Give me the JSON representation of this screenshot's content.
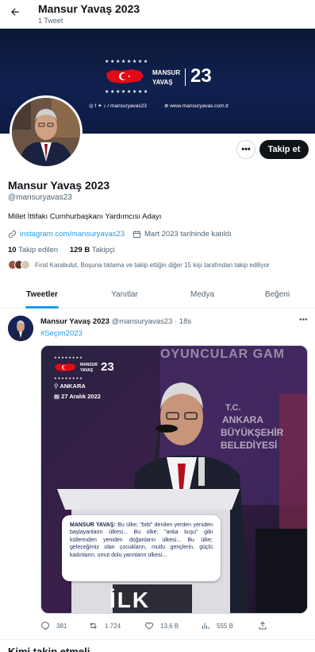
{
  "header": {
    "title": "Mansur Yavaş 2023",
    "subtitle": "1 Tweet"
  },
  "banner": {
    "stars": "★★★★★★★★",
    "name_line1": "MANSUR",
    "name_line2": "YAVAŞ",
    "number": "23",
    "social": "/ mansuryavas23",
    "website": "www.mansuryavas.com.tr"
  },
  "actions": {
    "more": "•••",
    "follow": "Takip et"
  },
  "profile": {
    "name": "Mansur Yavaş 2023",
    "handle": "@mansuryavas23",
    "bio": "Millet İttifakı Cumhurbaşkanı Yardımcısı Adayı",
    "link": "instagram.com/mansuryavas23",
    "joined": "Mart 2023 tarihinde katıldı",
    "following_count": "10",
    "following_label": "Takip edilen",
    "followers_count": "129 B",
    "followers_label": "Takipçi",
    "followed_by": "Fırat Karabulut, Boşuna tıklama ve takip ettiğin diğer 15 kişi tarafından takip ediliyor"
  },
  "tabs": [
    "Tweetler",
    "Yanıtlar",
    "Medya",
    "Beğeni"
  ],
  "tweet": {
    "name": "Mansur Yavaş 2023",
    "handle": "@mansuryavas23",
    "time": "· 18s",
    "hashtag": "#Seçim2023",
    "image": {
      "city": "ANKARA",
      "date": "27 Aralık 2022",
      "bg_text_1": "OYUNCULAR GAM",
      "bg_text_2": "T.C.",
      "bg_text_3": "ANKARA",
      "bg_text_4": "BÜYÜKŞEHİR",
      "bg_text_5": "BELEDİYESİ",
      "podium_text": "İLK",
      "quote_speaker": "MANSUR YAVAŞ:",
      "quote_text": "Bu ülke; \"bitti\" denilen yerden yeniden başlayanların ülkesi... Bu ülke; \"anka kuşu\" gibi küllerinden yeniden doğanların ülkesi... Bu ülke; geleceğimiz olan çocukların, mutlu gençlerin, güçlü kadınların, umut dolu yarınların ülkesi..."
    },
    "replies": "381",
    "retweets": "1.724",
    "likes": "13,6 B",
    "views": "555 B"
  },
  "who_to_follow": "Kimi takip etmeli",
  "colors": {
    "accent": "#1d9bf0",
    "text": "#0f1419",
    "muted": "#536471",
    "banner": "#0d1b44",
    "flag_red": "#e30a17"
  }
}
